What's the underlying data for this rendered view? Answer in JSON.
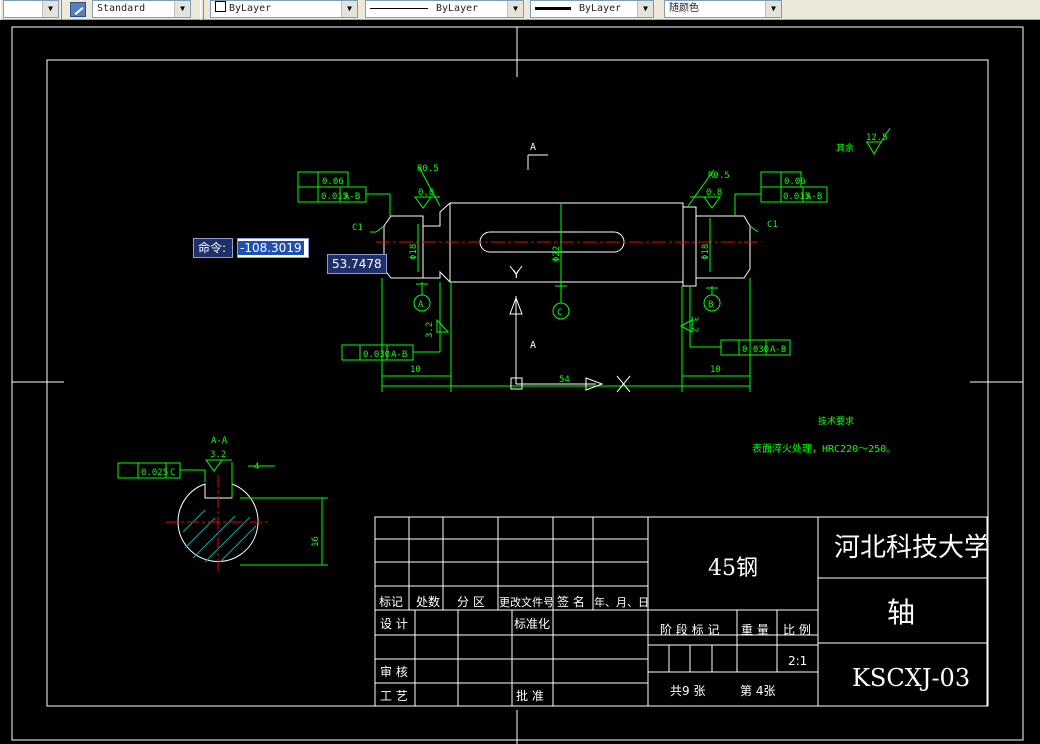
{
  "toolbar": {
    "text_style": "Standard",
    "layer": "ByLayer",
    "linetype": "ByLayer",
    "lineweight": "ByLayer",
    "color": "随颜色",
    "dropdown_arrow": "▼"
  },
  "prompt": {
    "command_label": "命令:",
    "input_value": "-108.3019",
    "coord_value": "53.7478"
  },
  "drawing": {
    "chamfer_left": "C1",
    "chamfer_right": "C1",
    "radius_left": "R0.5",
    "radius_right": "R0.5",
    "rough_08": "0.8",
    "rough_32": "3.2",
    "rough_125": "12.5",
    "rough_others": "其余",
    "tol_006": "0.06",
    "tol_0015": "0.015",
    "tol_003": "0.030",
    "tol_0025": "0.025",
    "datum_ab": "A-B",
    "datum_a": "A",
    "datum_b": "B",
    "datum_c": "C",
    "view_a": "A",
    "dim_dia_left": "Φ18",
    "dim_dia_mid": "Φ22",
    "dim_dia_right": "Φ18",
    "dim_10_left": "10",
    "dim_10_right": "10",
    "dim_54": "54",
    "ucs_y": "Y",
    "section_title": "A-A",
    "keyway_width": "4",
    "keyway_depth": "16",
    "tech_title": "技术要求",
    "tech_note": "表面淬火处理，HRC220～250。"
  },
  "titleblock": {
    "material": "45钢",
    "school": "河北科技大学",
    "part_name": "轴",
    "drawing_no": "KSCXJ-03",
    "header_mark": "标记",
    "header_count": "处数",
    "header_zone": "分 区",
    "header_change": "更改文件号",
    "header_sign": "签 名",
    "header_date": "年、月、日",
    "design": "设 计",
    "standardize": "标准化",
    "review": "审 核",
    "process": "工 艺",
    "approve": "批 准",
    "stage_mark": "阶 段 标 记",
    "weight": "重 量",
    "scale": "比 例",
    "scale_value": "2:1",
    "sheet_total": "共9  张",
    "sheet_no": "第  4张"
  }
}
